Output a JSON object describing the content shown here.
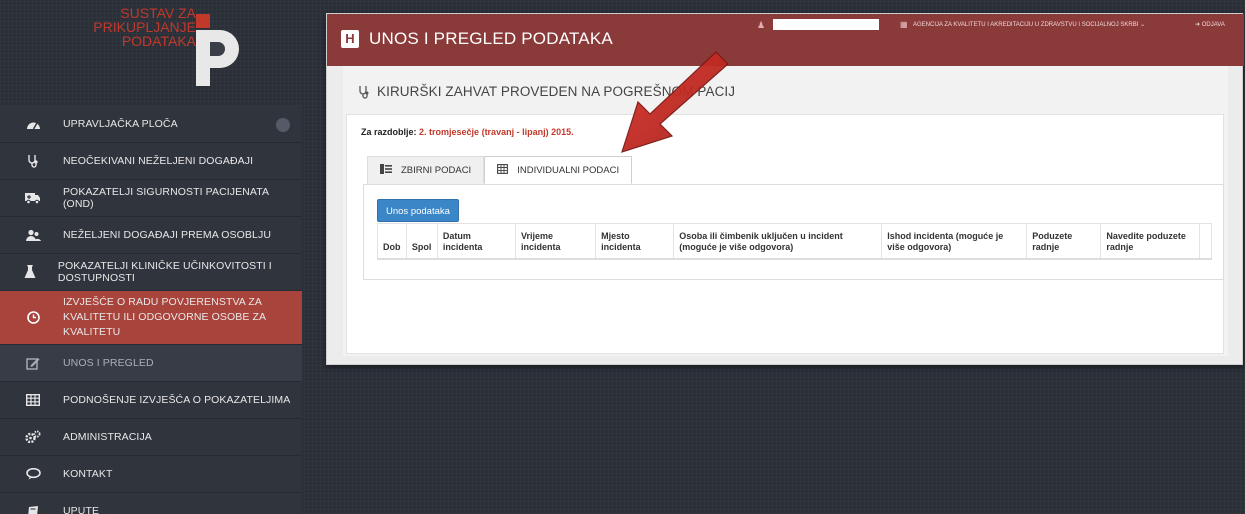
{
  "logo": {
    "line1": "SUSTAV ZA",
    "line2": "PRIKUPLJANJE",
    "line3": "PODATAKA"
  },
  "sidebar": {
    "items": [
      {
        "label": "UPRAVLJAČKA PLOČA",
        "icon": "dashboard-icon"
      },
      {
        "label": "NEOČEKIVANI NEŽELJENI DOGAĐAJI",
        "icon": "stethoscope-icon"
      },
      {
        "label": "POKAZATELJI SIGURNOSTI PACIJENATA (OND)",
        "icon": "ambulance-icon"
      },
      {
        "label": "NEŽELJENI DOGAĐAJI PREMA OSOBLJU",
        "icon": "users-icon"
      },
      {
        "label": "POKAZATELJI KLINIČKE UČINKOVITOSTI I DOSTUPNOSTI",
        "icon": "flask-icon"
      },
      {
        "label": "IZVJEŠĆE O RADU POVJERENSTVA ZA KVALITETU ILI ODGOVORNE OSOBE ZA KVALITETU",
        "icon": "clock-icon"
      },
      {
        "label": "UNOS I PREGLED",
        "icon": "edit-icon"
      },
      {
        "label": "PODNOŠENJE IZVJEŠĆA O POKAZATELJIMA",
        "icon": "table-icon"
      },
      {
        "label": "ADMINISTRACIJA",
        "icon": "cogs-icon"
      },
      {
        "label": "KONTAKT",
        "icon": "chat-icon"
      },
      {
        "label": "UPUTE",
        "icon": "book-icon"
      }
    ]
  },
  "header": {
    "title": "UNOS I PREGLED PODATAKA",
    "agency": "AGENCIJA ZA KVALITETU I AKREDITACIJU U ZDRAVSTVU I SOCIJALNOJ SKRBI",
    "logout": "ODJAVA"
  },
  "main": {
    "section_title": "KIRURŠKI ZAHVAT PROVEDEN NA POGREŠNOM PACIJ",
    "period_label": "Za razdoblje:",
    "period_value": "2. tromjesečje (travanj - lipanj) 2015.",
    "tabs": [
      {
        "label": "ZBIRNI PODACI"
      },
      {
        "label": "INDIVIDUALNI PODACI"
      }
    ],
    "add_button": "Unos podataka",
    "table": {
      "headers": [
        "Dob",
        "Spol",
        "Datum incidenta",
        "Vrijeme incidenta",
        "Mjesto incidenta",
        "Osoba ili čimbenik uključen u incident (moguće je više odgovora)",
        "Ishod incidenta (moguće je više odgovora)",
        "Poduzete radnje",
        "Navedite poduzete radnje"
      ]
    }
  },
  "colors": {
    "accent": "#8b3a3a",
    "active_nav": "#a8443c",
    "button": "#3a86c7",
    "period": "#c0392b"
  }
}
